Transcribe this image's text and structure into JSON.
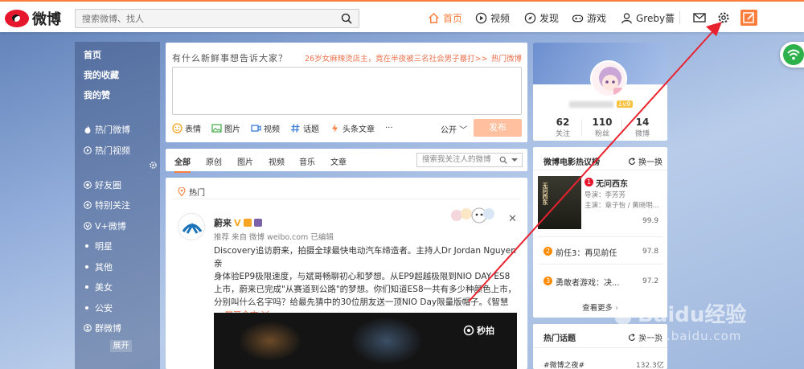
{
  "header": {
    "logo_text": "微博",
    "search_placeholder": "搜索微博、找人",
    "nav": [
      {
        "label": "首页",
        "active": true
      },
      {
        "label": "视频"
      },
      {
        "label": "发现"
      },
      {
        "label": "游戏"
      },
      {
        "label": "Greby薔"
      }
    ]
  },
  "leftnav": {
    "items": [
      {
        "label": "首页",
        "bold": true
      },
      {
        "label": "我的收藏",
        "bold": true
      },
      {
        "label": "我的赞",
        "bold": true
      },
      {
        "label": "热门微博",
        "icon": "fire-icon"
      },
      {
        "label": "热门视频",
        "icon": "video-icon"
      },
      {
        "label": "好友圈",
        "icon": "circle-icon"
      },
      {
        "label": "特别关注",
        "icon": "star-icon"
      },
      {
        "label": "V+微博",
        "icon": "vplus-icon"
      },
      {
        "label": "明星",
        "dot": true
      },
      {
        "label": "其他",
        "dot": true
      },
      {
        "label": "美女",
        "dot": true
      },
      {
        "label": "公安",
        "dot": true
      },
      {
        "label": "群微博",
        "icon": "group-icon"
      }
    ],
    "expand_label": "展开"
  },
  "publish": {
    "prompt": "有什么新鲜事想告诉大家？",
    "hot_topic": "26岁女麻辣烫店主，竟在半夜被三名社会男子暴打>>",
    "hot_link": "热门微博",
    "tools": [
      "表情",
      "图片",
      "视频",
      "话题",
      "头条文章"
    ],
    "more": "···",
    "visibility": "公开",
    "send": "发布"
  },
  "feed_tabs": {
    "tabs": [
      "全部",
      "原创",
      "图片",
      "视频",
      "音乐",
      "文章"
    ],
    "search_placeholder": "搜索我关注人的微博"
  },
  "feed": {
    "section_label": "热门",
    "post": {
      "author": "蔚来",
      "meta": "推荐 来自 微博 weibo.com  已编辑",
      "lines": [
        "Discovery追访蔚来，拍摄全球最快电动汽车缔造者。主持人Dr Jordan Nguyen亲",
        "身体验EP9极限速度，与斌哥畅聊初心和梦想。从EP9超越极限到NIO DAY ES8",
        "上市，蔚来已完成\"从赛道到公路\"的梦想。你们知道ES8一共有多少种颜色上市，",
        "分别叫什么名字吗？给最先猜中的30位朋友送一顶NIO Day限量版帽子。《智慧"
      ],
      "expand_label": "... 展开全文 ﹀",
      "video_brand": "秒拍"
    }
  },
  "profile": {
    "level": "Lv9",
    "stats": [
      {
        "num": "62",
        "label": "关注"
      },
      {
        "num": "110",
        "label": "粉丝"
      },
      {
        "num": "14",
        "label": "微博"
      }
    ]
  },
  "movies": {
    "title": "微博电影热议榜",
    "refresh": "换一换",
    "items": [
      {
        "rank": "1",
        "name": "无问西东",
        "director": "导演：李芳芳",
        "cast": "主演：章子怡 / 黄晓明...",
        "score": "99.9",
        "poster_text": "无问西东"
      },
      {
        "rank": "2",
        "name": "前任3：再见前任",
        "score": "97.8"
      },
      {
        "rank": "3",
        "name": "勇敢者游戏：决...",
        "score": "97.2"
      }
    ],
    "more": "查看更多 ›"
  },
  "topics": {
    "title": "热门话题",
    "refresh": "换一换",
    "first_item": "#微博之夜#",
    "first_count": "132.3亿"
  },
  "watermark": {
    "brand": "Baidu经验",
    "url": "jingyan.baidu.com"
  },
  "colors": {
    "accent": "#fa7d3c",
    "link": "#eb7350",
    "annotation_arrow": "#e8222e"
  }
}
